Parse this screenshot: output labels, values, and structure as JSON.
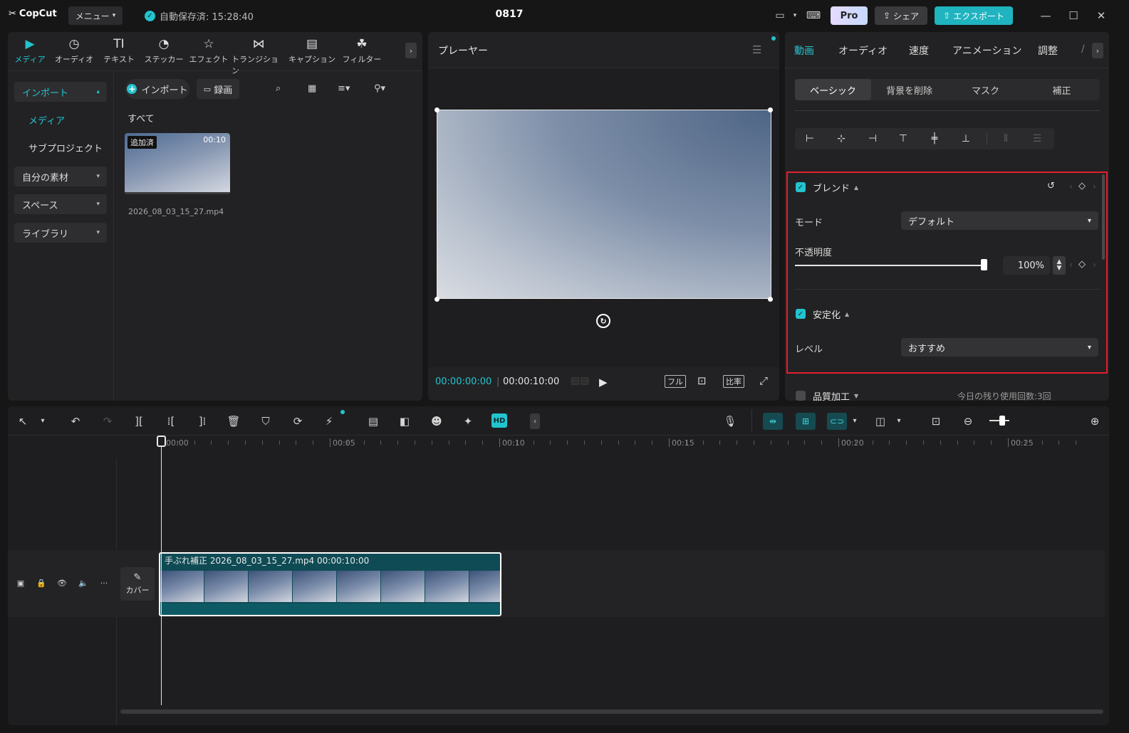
{
  "titlebar": {
    "logo": "CopCut",
    "menu_label": "メニュー",
    "autosave": "自動保存済: 15:28:40",
    "project_title": "0817",
    "pro_label": "Pro",
    "share_label": "シェア",
    "export_label": "エクスポート"
  },
  "media_tabs": [
    {
      "label": "メディア",
      "icon": "media-icon"
    },
    {
      "label": "オーディオ",
      "icon": "audio-icon"
    },
    {
      "label": "テキスト",
      "icon": "text-icon"
    },
    {
      "label": "ステッカー",
      "icon": "sticker-icon"
    },
    {
      "label": "エフェクト",
      "icon": "effect-icon"
    },
    {
      "label": "トランジション",
      "icon": "transition-icon"
    },
    {
      "label": "キャプション",
      "icon": "caption-icon"
    },
    {
      "label": "フィルター",
      "icon": "filter-icon"
    }
  ],
  "media_sidebar": {
    "import": "インポート",
    "media": "メディア",
    "subproject": "サブプロジェクト",
    "my_assets": "自分の素材",
    "space": "スペース",
    "library": "ライブラリ"
  },
  "media_main": {
    "import_btn": "インポート",
    "record_btn": "録画",
    "all_label": "すべて",
    "clip": {
      "badge": "追加済",
      "duration": "00:10",
      "filename": "2026_08_03_15_27.mp4"
    }
  },
  "player": {
    "title": "プレーヤー",
    "time_current": "00:00:00:00",
    "time_total": "00:00:10:00",
    "full_label": "フル",
    "ratio_label": "比率"
  },
  "props": {
    "tabs": [
      "動画",
      "オーディオ",
      "速度",
      "アニメーション",
      "調整"
    ],
    "subtabs": [
      "ベーシック",
      "背景を削除",
      "マスク",
      "補正"
    ],
    "blend": {
      "title": "ブレンド",
      "mode_label": "モード",
      "mode_value": "デフォルト",
      "opacity_label": "不透明度",
      "opacity_value": "100%"
    },
    "stabilize": {
      "title": "安定化",
      "level_label": "レベル",
      "level_value": "おすすめ"
    },
    "quality": {
      "title": "品質加工",
      "quota": "今日の残り使用回数:3回"
    }
  },
  "timeline": {
    "ruler": [
      "00:00",
      "00:05",
      "00:10",
      "00:15",
      "00:20",
      "00:25"
    ],
    "cover_label": "カバー",
    "clip_label": "手ぶれ補正  2026_08_03_15_27.mp4  00:00:10:00"
  }
}
